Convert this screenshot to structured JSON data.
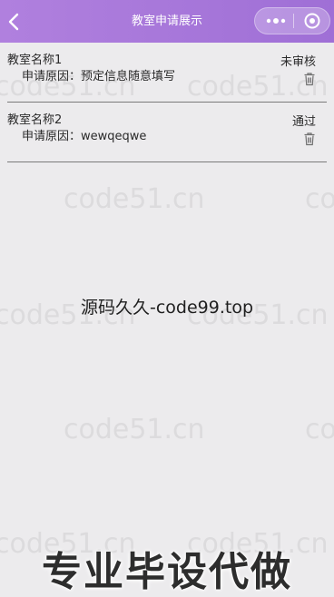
{
  "nav": {
    "title": "教室申请展示",
    "back_icon": "chevron-left-icon",
    "more_icon": "more-dots-icon",
    "close_icon": "capsule-close-icon"
  },
  "applications": [
    {
      "name": "教室名称1",
      "reason_label": "申请原因：",
      "reason": "预定信息随意填写",
      "status": "未审核",
      "delete_icon": "trash-icon"
    },
    {
      "name": "教室名称2",
      "reason_label": "申请原因：",
      "reason": "wewqeqwe",
      "status": "通过",
      "delete_icon": "trash-icon"
    }
  ],
  "watermark": {
    "text": "code51.cn",
    "center_text": "源码久久-code99.top",
    "banner": "专业毕设代做"
  },
  "colors": {
    "nav_bar": "#a777da",
    "background": "#ecebed",
    "text": "#2a2a2a"
  }
}
